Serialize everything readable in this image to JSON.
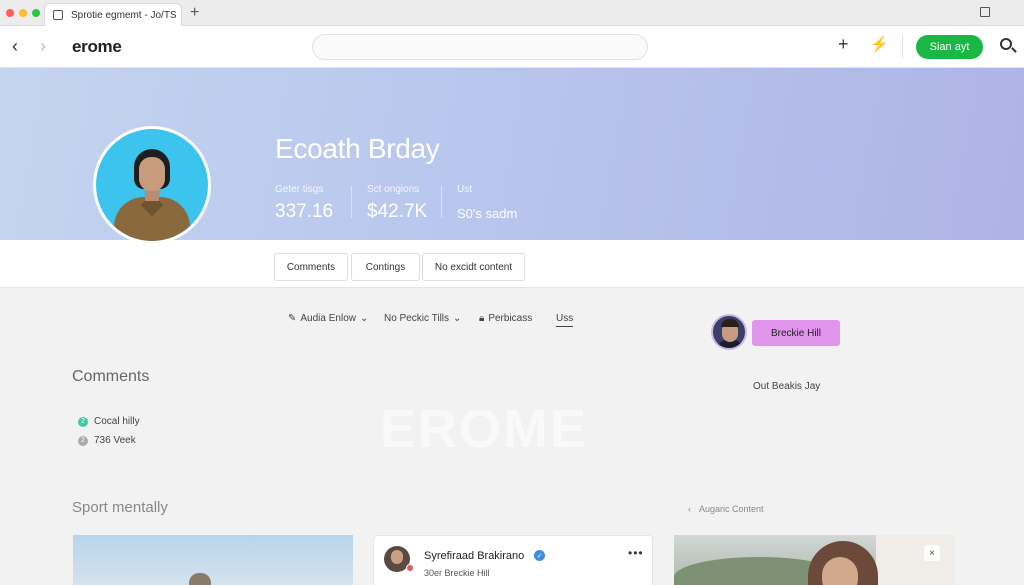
{
  "browser": {
    "tab_title": "Sprotie egmemt - Jo/TS",
    "new_tab": "+",
    "close": "×",
    "traffic_colors": [
      "#ff5f57",
      "#febc2e",
      "#28c840"
    ]
  },
  "nav": {
    "back": "‹",
    "forward": "›",
    "logo": "erome",
    "plus": "+",
    "bolt": "⚡",
    "signin_label": "Sian ayt",
    "signin_color": "#1ab744"
  },
  "profile": {
    "name": "Ecoath Brday",
    "stats": [
      {
        "label": "Geter tisgs",
        "value": "337.16"
      },
      {
        "label": "Sct ongions",
        "value": "$42.7K"
      },
      {
        "label": "Ust",
        "value": "S0's sadm"
      }
    ]
  },
  "profile_tabs": [
    "Comments",
    "Contings",
    "No excidt content"
  ],
  "filters": [
    {
      "icon": "pencil-icon",
      "label": "Audia Enlow",
      "caret": "⌄"
    },
    {
      "label": "No Peckic Tills",
      "caret": "⌄"
    },
    {
      "icon": "lock-icon",
      "label": "Perbicass"
    },
    {
      "label": "Uss"
    }
  ],
  "side": {
    "follow_label": "Breckie Hill",
    "follow_color": "#e295ec",
    "out_text": "Out Beakis Jay"
  },
  "comments": {
    "title": "Comments",
    "items": [
      {
        "glyph": "2",
        "text": "Cocal hilly",
        "color": "#3ec9a7"
      },
      {
        "glyph": "2",
        "text": "736 Veek",
        "color": "#aaaaaa"
      }
    ]
  },
  "watermark": "EROME",
  "section": {
    "title": "Sport mentally",
    "related_label": "Augaric Content",
    "related_icon": "‹"
  },
  "post": {
    "name": "Syrefiraad Brakirano",
    "sub": "30er Breckie Hill",
    "verified": "✓",
    "more": "•••"
  },
  "card_close": "×"
}
